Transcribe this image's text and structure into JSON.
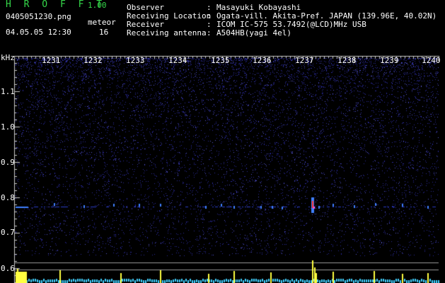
{
  "app": {
    "name": "H R O F F T",
    "version": "1.00"
  },
  "file": {
    "name": "0405051230.png",
    "timestamp": "04.05.05 12:30"
  },
  "meteor": {
    "label": "meteor",
    "count": "16"
  },
  "info": [
    {
      "key": "Observer",
      "colon": ":",
      "value": "Masayuki Kobayashi"
    },
    {
      "key": "Receiving Location",
      "colon": ":",
      "value": "Ogata-vill. Akita-Pref. JAPAN (139.96E, 40.02N)"
    },
    {
      "key": "Receiver",
      "colon": ":",
      "value": "ICOM IC-575 53.7492(@LCD)MHz USB"
    },
    {
      "key": "Receiving antenna",
      "colon": ":",
      "value": "A504HB(yagi 4el)"
    }
  ],
  "spectrogram": {
    "unit_label": "kHz",
    "time_ticks": [
      "1231",
      "1232",
      "1233",
      "1234",
      "1235",
      "1236",
      "1237",
      "1238",
      "1239",
      "1240"
    ],
    "freq_ticks": [
      "1.1",
      "1.0",
      "0.9",
      "0.8",
      "0.7",
      "0.6"
    ],
    "colors": {
      "background": "#000000",
      "noise": "#2b2b9e",
      "signal": "#3f7fff",
      "hot": "#ff3030",
      "bars": "#ffff40",
      "base": "#40d0ff"
    }
  }
}
